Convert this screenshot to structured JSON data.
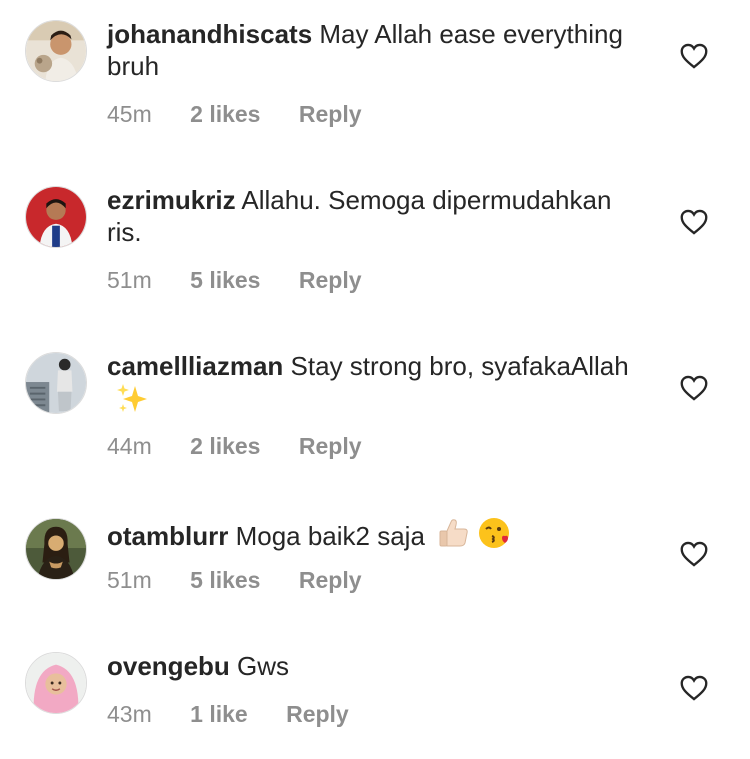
{
  "comments": [
    {
      "username": "johanandhiscats",
      "text": "May Allah ease everything bruh",
      "time": "45m",
      "likes": "2 likes",
      "reply": "Reply",
      "avatar_icon": "avatar-man-with-cat",
      "emojis": []
    },
    {
      "username": "ezrimukriz",
      "text": "Allahu. Semoga dipermudahkan ris.",
      "time": "51m",
      "likes": "5 likes",
      "reply": "Reply",
      "avatar_icon": "avatar-man-red-background",
      "emojis": []
    },
    {
      "username": "camellliazman",
      "text": "Stay strong bro, syafakaAllah",
      "time": "44m",
      "likes": "2 likes",
      "reply": "Reply",
      "avatar_icon": "avatar-person-standing",
      "emojis": [
        "sparkles-icon"
      ]
    },
    {
      "username": "otamblurr",
      "text": "Moga baik2 saja",
      "time": "51m",
      "likes": "5 likes",
      "reply": "Reply",
      "avatar_icon": "avatar-mona-lisa",
      "emojis": [
        "thumbs-up-icon",
        "kissing-face-icon"
      ]
    },
    {
      "username": "ovengebu",
      "text": "Gws",
      "time": "43m",
      "likes": "1 like",
      "reply": "Reply",
      "avatar_icon": "avatar-woman-hijab",
      "emojis": []
    }
  ],
  "colors": {
    "text": "#262626",
    "meta": "#8e8e8e",
    "heart_stroke": "#262626"
  }
}
